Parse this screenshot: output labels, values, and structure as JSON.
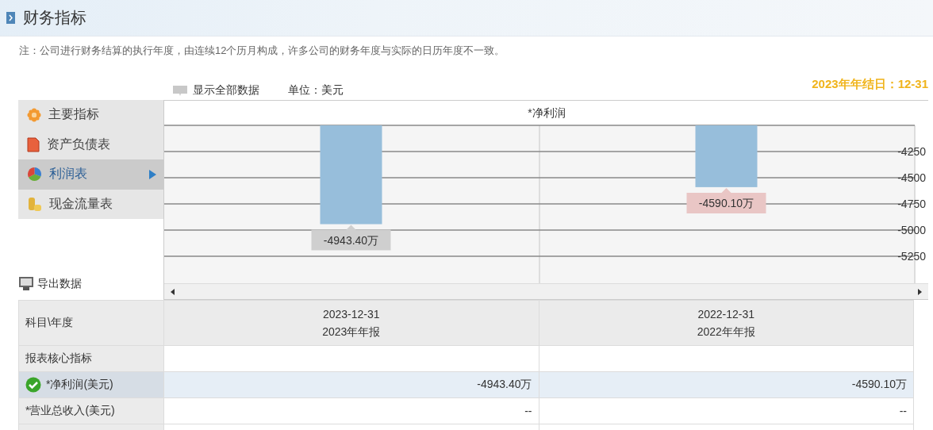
{
  "header": {
    "title": "财务指标"
  },
  "note": "注：公司进行财务结算的执行年度，由连续12个历月构成，许多公司的财务年度与实际的日历年度不一致。",
  "toolbar": {
    "show_all": "显示全部数据",
    "unit": "单位：美元",
    "fiscal_year_end": "2023年年结日：12-31"
  },
  "sidebar": {
    "items": [
      {
        "label": "主要指标",
        "selected": false
      },
      {
        "label": "资产负债表",
        "selected": false
      },
      {
        "label": "利润表",
        "selected": true
      },
      {
        "label": "现金流量表",
        "selected": false
      }
    ],
    "export": "导出数据"
  },
  "chart": {
    "bars": [
      {
        "selected": false
      },
      {
        "selected": true
      }
    ],
    "chart_data": {
      "type": "bar",
      "grid": true,
      "title": "*净利润",
      "values": [
        -4943.4,
        -4590.1
      ],
      "value_labels": [
        "-4943.40万",
        "-4590.10万"
      ],
      "ylim": [
        -5500,
        -4000
      ],
      "yticks": [
        -4250,
        -4500,
        -4750,
        -5000,
        -5250
      ]
    }
  },
  "table": {
    "columns": [
      {
        "date": "2023-12-31",
        "report": "2023年年报"
      },
      {
        "date": "2022-12-31",
        "report": "2022年年报"
      }
    ],
    "corner": "科目\\年度",
    "rows": [
      {
        "kind": "section",
        "label": "报表核心指标",
        "cells": []
      },
      {
        "kind": "metric",
        "label": "*净利润(美元)",
        "selected": true,
        "cells": [
          "-4943.40万",
          "-4590.10万"
        ]
      },
      {
        "kind": "metric",
        "label": "*营业总收入(美元)",
        "selected": false,
        "cells": [
          "--",
          "--"
        ]
      }
    ]
  }
}
